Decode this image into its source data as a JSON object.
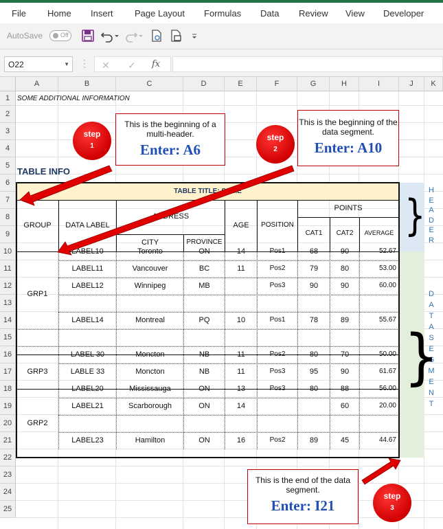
{
  "ribbon": {
    "tabs": [
      "File",
      "Home",
      "Insert",
      "Page Layout",
      "Formulas",
      "Data",
      "Review",
      "View",
      "Developer"
    ]
  },
  "qat": {
    "autosave_label": "AutoSave",
    "toggle_label": "Off",
    "icons": [
      "save-icon",
      "undo-icon",
      "redo-icon",
      "touch-mode-icon",
      "print-preview-icon",
      "customize-qat-icon"
    ]
  },
  "formula_bar": {
    "name_box": "O22",
    "fx_label": "fx",
    "formula": ""
  },
  "columns": [
    "A",
    "B",
    "C",
    "D",
    "E",
    "F",
    "G",
    "H",
    "I",
    "J",
    "K"
  ],
  "rows": [
    "1",
    "2",
    "3",
    "4",
    "5",
    "6",
    "7",
    "8",
    "9",
    "10",
    "11",
    "12",
    "13",
    "14",
    "15",
    "16",
    "17",
    "18",
    "19",
    "20",
    "21",
    "22",
    "23",
    "24",
    "25"
  ],
  "sheet": {
    "note": "SOME ADDITIONAL INFORMATION",
    "table_info": "TABLE INFO",
    "table_title": "TABLE TITLE: SOME",
    "headers": {
      "group": "GROUP",
      "data_label": "DATA LABEL",
      "address": "ADDRESS",
      "city": "CITY",
      "province": "PROVINCE",
      "age": "AGE",
      "position": "POSITION",
      "points": "POINTS",
      "cat1": "CAT1",
      "cat2": "CAT2",
      "average": "AVERAGE"
    },
    "groups": [
      "GRP1",
      "GRP3",
      "GRP2"
    ],
    "rows": [
      {
        "label": "LABEL10",
        "city": "Toronto",
        "prov": "ON",
        "age": "14",
        "pos": "Pos1",
        "cat1": "68",
        "cat2": "90",
        "avg": "52.67"
      },
      {
        "label": "LABEL11",
        "city": "Vancouver",
        "prov": "BC",
        "age": "11",
        "pos": "Pos2",
        "cat1": "79",
        "cat2": "80",
        "avg": "53.00"
      },
      {
        "label": "LABEL12",
        "city": "Winnipeg",
        "prov": "MB",
        "age": "",
        "pos": "Pos3",
        "cat1": "90",
        "cat2": "90",
        "avg": "60.00"
      },
      {
        "label": "",
        "city": "",
        "prov": "",
        "age": "",
        "pos": "",
        "cat1": "",
        "cat2": "",
        "avg": ""
      },
      {
        "label": "LABEL14",
        "city": "Montreal",
        "prov": "PQ",
        "age": "10",
        "pos": "Pos1",
        "cat1": "78",
        "cat2": "89",
        "avg": "55.67"
      },
      {
        "label": "",
        "city": "",
        "prov": "",
        "age": "",
        "pos": "",
        "cat1": "",
        "cat2": "",
        "avg": ""
      },
      {
        "label": "LABEL 30",
        "city": "Moncton",
        "prov": "NB",
        "age": "11",
        "pos": "Pos2",
        "cat1": "80",
        "cat2": "70",
        "avg": "50.00"
      },
      {
        "label": "LABLE 33",
        "city": "Moncton",
        "prov": "NB",
        "age": "11",
        "pos": "Pos3",
        "cat1": "95",
        "cat2": "90",
        "avg": "61.67"
      },
      {
        "label": "LABEL20",
        "city": "Mississauga",
        "prov": "ON",
        "age": "13",
        "pos": "Pos3",
        "cat1": "80",
        "cat2": "88",
        "avg": "56.00"
      },
      {
        "label": "LABEL21",
        "city": "Scarborough",
        "prov": "ON",
        "age": "14",
        "pos": "",
        "cat1": "",
        "cat2": "60",
        "avg": "20.00"
      },
      {
        "label": "",
        "city": "",
        "prov": "",
        "age": "",
        "pos": "",
        "cat1": "",
        "cat2": "",
        "avg": ""
      },
      {
        "label": "LABEL23",
        "city": "Hamilton",
        "prov": "ON",
        "age": "16",
        "pos": "Pos2",
        "cat1": "89",
        "cat2": "45",
        "avg": "44.67"
      }
    ],
    "header_side_label": [
      "H",
      "E",
      "A",
      "D",
      "E",
      "R"
    ],
    "data_side_label": [
      "D",
      "A",
      "T",
      "A",
      "S",
      "E",
      "G",
      "M",
      "E",
      "N",
      "T"
    ]
  },
  "callouts": {
    "c1": {
      "text": "This is the beginning of a multi-header.",
      "enter": "Enter:  A6",
      "step": "step",
      "num": "1"
    },
    "c2": {
      "text": "This is the beginning of the data segment.",
      "enter": "Enter:  A10",
      "step": "step",
      "num": "2"
    },
    "c3": {
      "text": "This is the end of the data segment.",
      "enter": "Enter:  I21",
      "step": "step",
      "num": "3"
    }
  },
  "colors": {
    "accent": "#217346",
    "header_fill": "#fff2cc",
    "callout_border": "#c00000",
    "enter_text": "#1f4fb5",
    "side_label": "#2e74b5",
    "arrow": "#e00000"
  }
}
